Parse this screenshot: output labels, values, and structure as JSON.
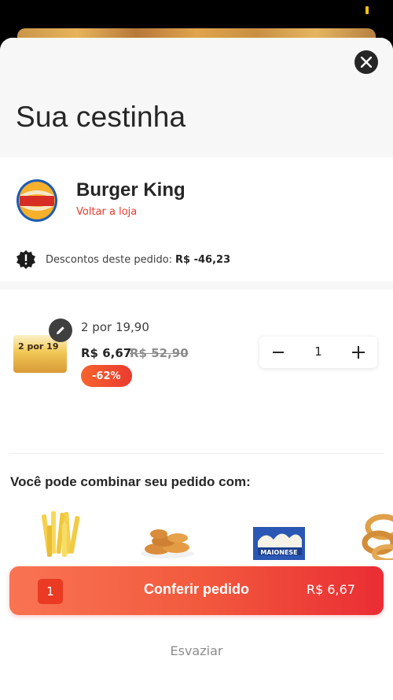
{
  "header": {
    "title": "Sua cestinha"
  },
  "store": {
    "name": "Burger King",
    "back_link": "Voltar a loja"
  },
  "discount": {
    "label": "Descontos deste pedido:",
    "value": "R$ -46,23"
  },
  "cart_item": {
    "name": "2 por 19,90",
    "image_label": "2 por 19",
    "price": "R$ 6,67",
    "original_price": "R$ 52,90",
    "discount_badge": "-62%",
    "quantity": "1"
  },
  "suggestions": {
    "title": "Você pode combinar seu pedido com:",
    "items": [
      {
        "icon": "fries-icon"
      },
      {
        "icon": "nuggets-icon"
      },
      {
        "icon": "mayonnaise-icon",
        "label": "MAIONESE"
      },
      {
        "icon": "onion-rings-icon"
      }
    ]
  },
  "checkout": {
    "count": "1",
    "label": "Conferir pedido",
    "total": "R$ 6,67"
  },
  "empty_button": "Esvaziar",
  "colors": {
    "accent": "#ea3a2f",
    "text": "#262626",
    "gradient_start": "#f97453",
    "gradient_end": "#ea2d34"
  }
}
